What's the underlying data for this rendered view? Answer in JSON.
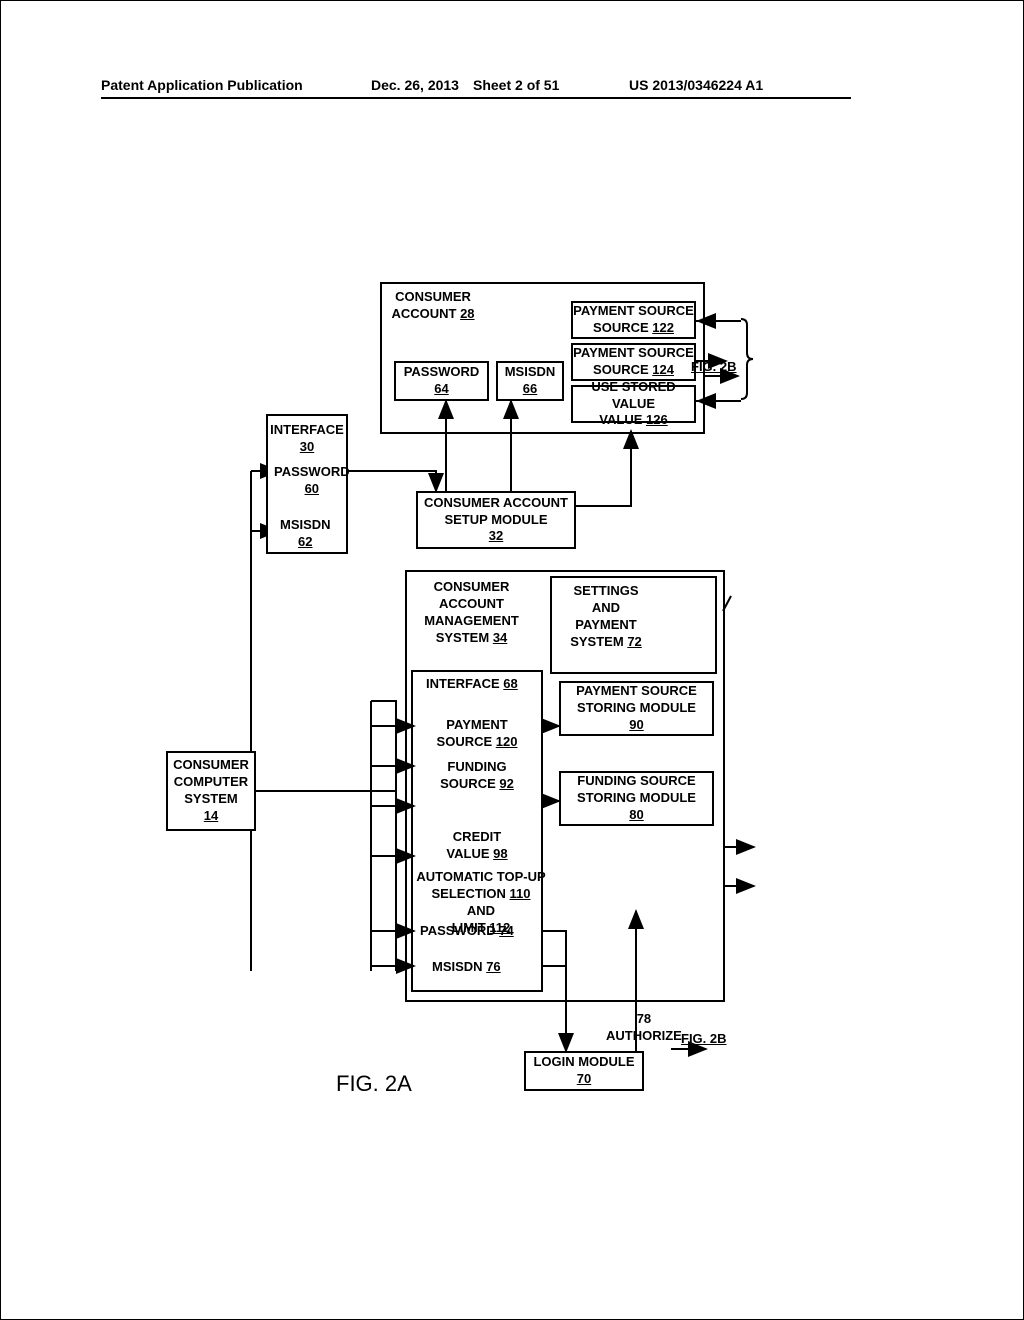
{
  "header": {
    "pub": "Patent Application Publication",
    "date": "Dec. 26, 2013",
    "sheet": "Sheet 2 of 51",
    "num": "US 2013/0346224 A1"
  },
  "boxes": {
    "consumer_account": {
      "label": "CONSUMER ACCOUNT",
      "ref": "28"
    },
    "password64": {
      "label": "PASSWORD",
      "ref": "64"
    },
    "msisdn66": {
      "label": "MSISDN",
      "ref": "66"
    },
    "payment122": {
      "label": "PAYMENT SOURCE",
      "ref": "122"
    },
    "payment124": {
      "label": "PAYMENT SOURCE",
      "ref": "124"
    },
    "use_stored126": {
      "label": "USE STORED VALUE",
      "ref": "126"
    },
    "interface30": {
      "label": "INTERFACE",
      "ref": "30"
    },
    "password60": {
      "label": "PASSWORD",
      "ref": "60"
    },
    "msisdn62": {
      "label": "MSISDN",
      "ref": "62"
    },
    "setup32": {
      "label": "CONSUMER ACCOUNT SETUP MODULE",
      "ref": "32"
    },
    "cams34": {
      "label": "CONSUMER ACCOUNT MANAGEMENT SYSTEM",
      "ref": "34"
    },
    "settings72": {
      "label": "SETTINGS AND PAYMENT SYSTEM",
      "ref": "72"
    },
    "interface68": {
      "label": "INTERFACE",
      "ref": "68"
    },
    "pss90": {
      "label": "PAYMENT SOURCE STORING MODULE",
      "ref": "90"
    },
    "payment120": {
      "label": "PAYMENT SOURCE",
      "ref": "120"
    },
    "funding92": {
      "label": "FUNDING SOURCE",
      "ref": "92"
    },
    "fss80": {
      "label": "FUNDING SOURCE STORING MODULE",
      "ref": "80"
    },
    "credit98": {
      "label": "CREDIT VALUE",
      "ref": "98"
    },
    "topup": {
      "label": "AUTOMATIC TOP-UP SELECTION",
      "ref": "110",
      "label2": "AND LIMIT",
      "ref2": "112"
    },
    "password74": {
      "label": "PASSWORD",
      "ref": "74"
    },
    "msisdn76": {
      "label": "MSISDN",
      "ref": "76"
    },
    "consumer14": {
      "label": "CONSUMER COMPUTER SYSTEM",
      "ref": "14"
    },
    "login70": {
      "label": "LOGIN MODULE",
      "ref": "70"
    },
    "authorize": {
      "label": "AUTHORIZE",
      "ref": "78"
    }
  },
  "figlabel": "FIG. 2A",
  "figref2b": "FIG. 2B"
}
